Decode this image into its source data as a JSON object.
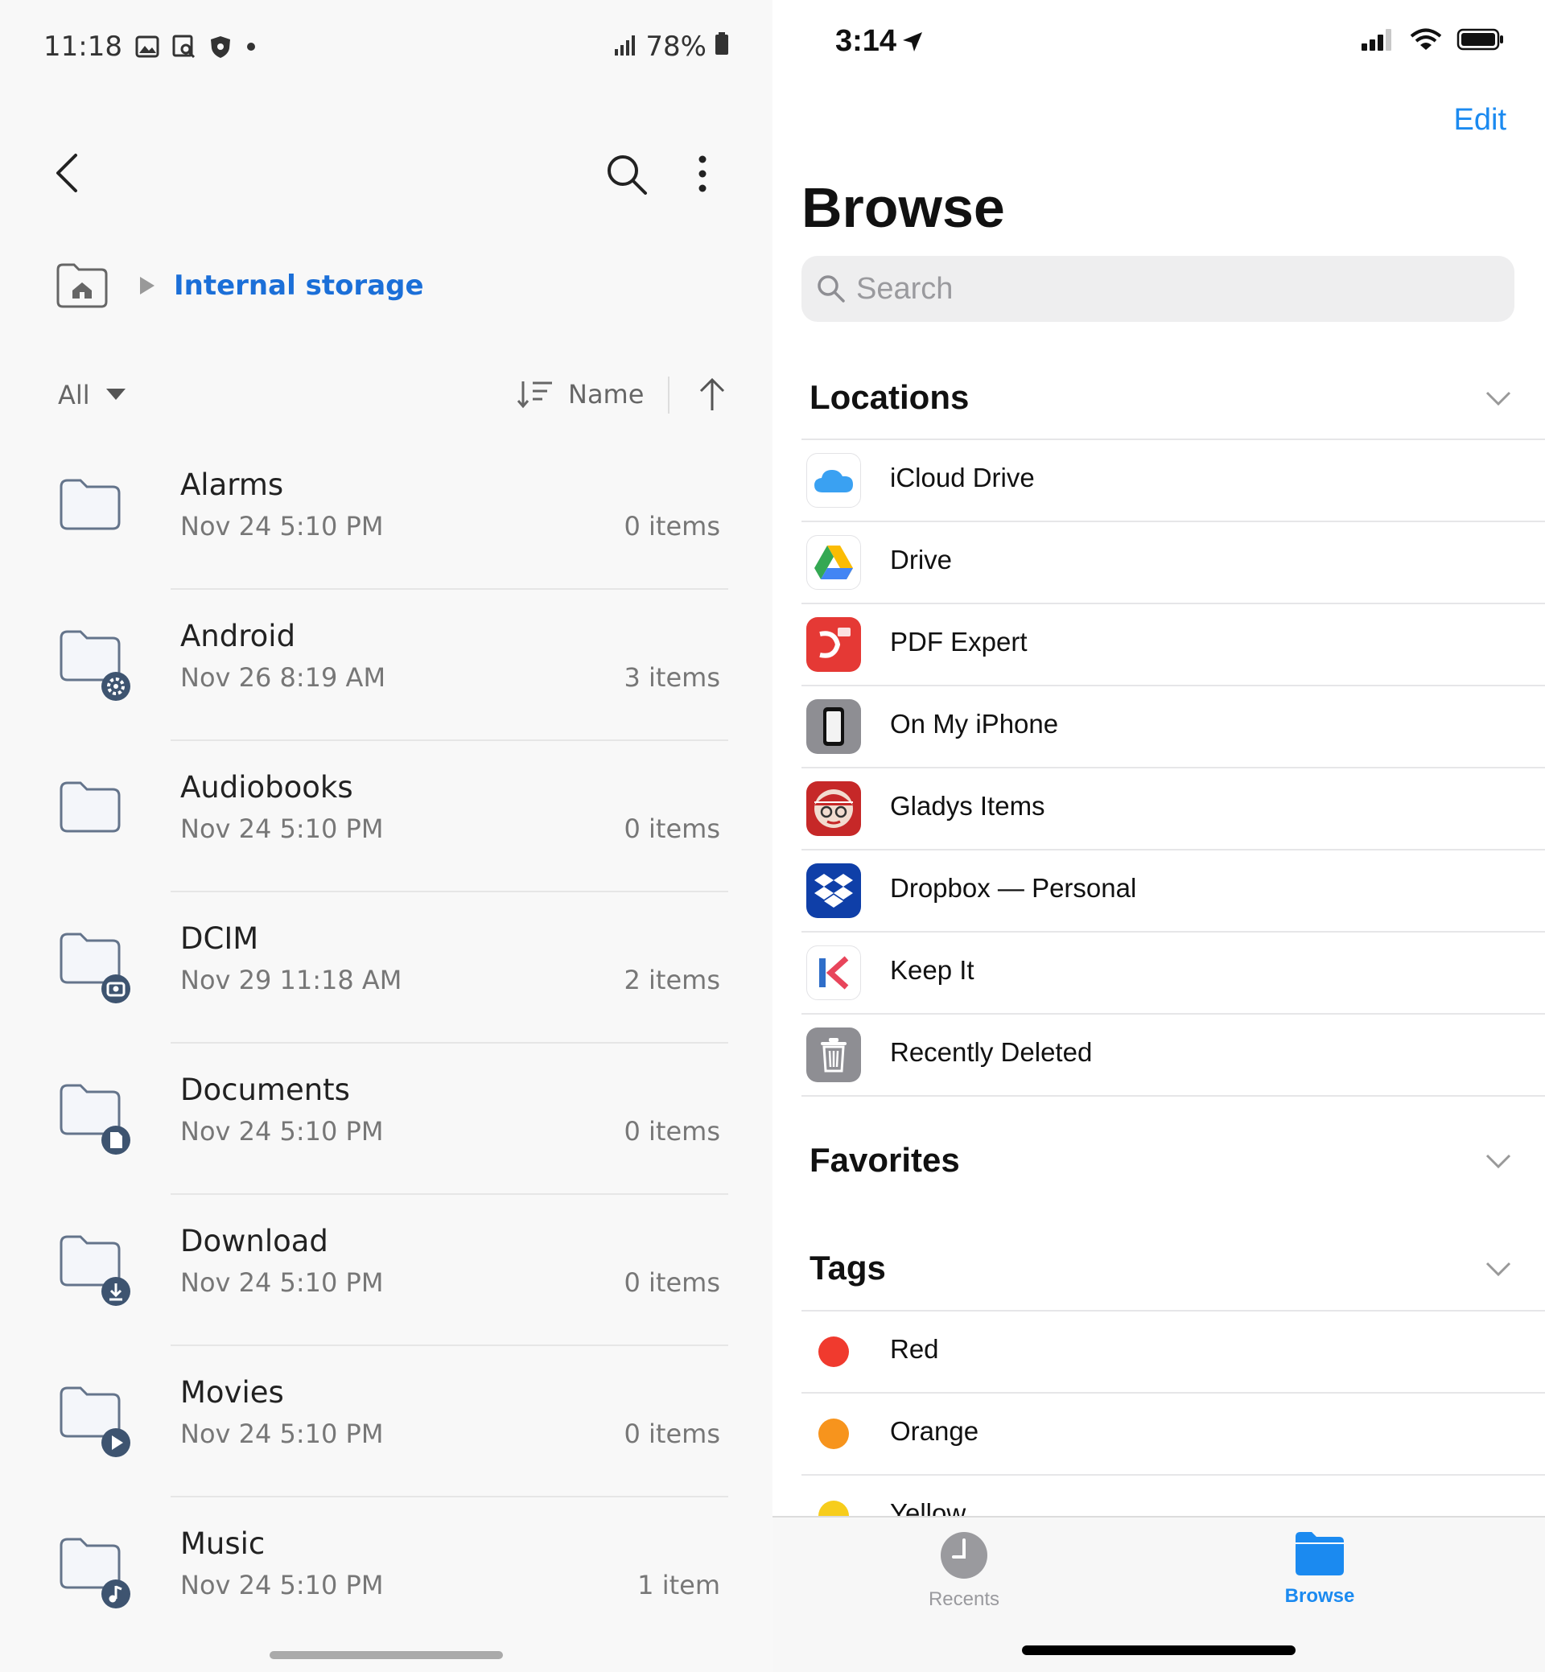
{
  "android": {
    "status": {
      "time": "11:18",
      "battery": "78%"
    },
    "breadcrumb": {
      "label": "Internal storage"
    },
    "filter": {
      "label": "All",
      "sort_label": "Name"
    },
    "folders": [
      {
        "name": "Alarms",
        "date": "Nov 24 5:10 PM",
        "count": "0 items",
        "icon": "folder-icon"
      },
      {
        "name": "Android",
        "date": "Nov 26 8:19 AM",
        "count": "3 items",
        "icon": "folder-settings-icon"
      },
      {
        "name": "Audiobooks",
        "date": "Nov 24 5:10 PM",
        "count": "0 items",
        "icon": "folder-icon"
      },
      {
        "name": "DCIM",
        "date": "Nov 29 11:18 AM",
        "count": "2 items",
        "icon": "folder-camera-icon"
      },
      {
        "name": "Documents",
        "date": "Nov 24 5:10 PM",
        "count": "0 items",
        "icon": "folder-document-icon"
      },
      {
        "name": "Download",
        "date": "Nov 24 5:10 PM",
        "count": "0 items",
        "icon": "folder-download-icon"
      },
      {
        "name": "Movies",
        "date": "Nov 24 5:10 PM",
        "count": "0 items",
        "icon": "folder-play-icon"
      },
      {
        "name": "Music",
        "date": "Nov 24 5:10 PM",
        "count": "1 item",
        "icon": "folder-music-icon"
      }
    ],
    "colors": {
      "accent": "#1b6fd8",
      "folder_badge": "#3e5470"
    }
  },
  "ios": {
    "status": {
      "time": "3:14"
    },
    "edit_label": "Edit",
    "title": "Browse",
    "search_placeholder": "Search",
    "sections": {
      "locations": "Locations",
      "favorites": "Favorites",
      "tags": "Tags"
    },
    "locations": [
      {
        "label": "iCloud Drive",
        "icon": "icloud-icon"
      },
      {
        "label": "Drive",
        "icon": "google-drive-icon"
      },
      {
        "label": "PDF Expert",
        "icon": "pdf-expert-icon"
      },
      {
        "label": "On My iPhone",
        "icon": "iphone-icon"
      },
      {
        "label": "Gladys Items",
        "icon": "gladys-icon"
      },
      {
        "label": "Dropbox — Personal",
        "icon": "dropbox-icon"
      },
      {
        "label": "Keep It",
        "icon": "keep-it-icon"
      },
      {
        "label": "Recently Deleted",
        "icon": "trash-icon"
      }
    ],
    "tags": [
      {
        "label": "Red",
        "color": "#f03a2e"
      },
      {
        "label": "Orange",
        "color": "#f7941d"
      },
      {
        "label": "Yellow",
        "color": "#f7cd1c"
      }
    ],
    "tabs": {
      "recents": "Recents",
      "browse": "Browse"
    },
    "colors": {
      "accent": "#1b8af0"
    }
  }
}
